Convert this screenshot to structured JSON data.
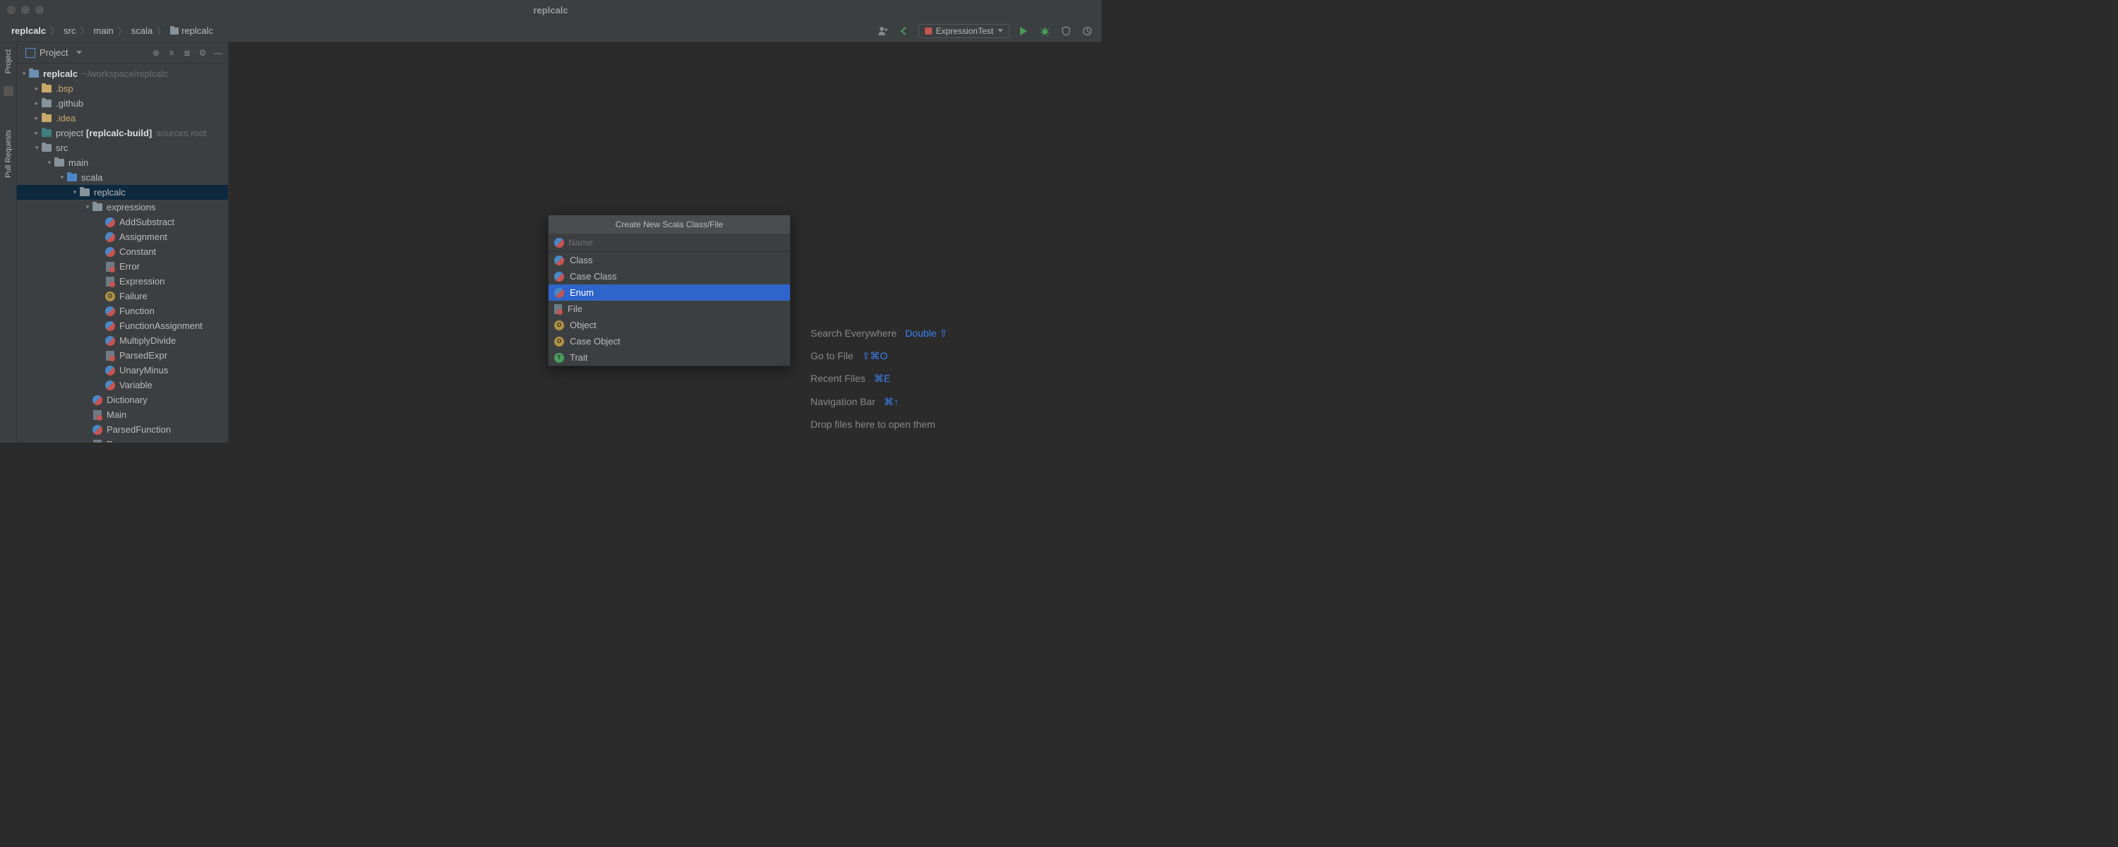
{
  "window": {
    "title": "replcalc"
  },
  "breadcrumbs": [
    "replcalc",
    "src",
    "main",
    "scala",
    "replcalc"
  ],
  "runConfig": {
    "name": "ExpressionTest"
  },
  "sidebar": {
    "view_label": "Project",
    "root": {
      "name": "replcalc",
      "path": "~/workspace/replcalc"
    },
    "folders": {
      "bsp": ".bsp",
      "github": ".github",
      "idea": ".idea",
      "project_label": "project",
      "project_bold": "[replcalc-build]",
      "project_hint": "sources root",
      "src": "src",
      "main": "main",
      "scala": "scala",
      "pkg": "replcalc",
      "expressions": "expressions"
    },
    "files": {
      "addsub": "AddSubstract",
      "assignment": "Assignment",
      "constant": "Constant",
      "error": "Error",
      "expression": "Expression",
      "failure": "Failure",
      "function": "Function",
      "funcassign": "FunctionAssignment",
      "muldiv": "MultiplyDivide",
      "parsedexpr": "ParsedExpr",
      "unaryminus": "UnaryMinus",
      "variable": "Variable",
      "dictionary": "Dictionary",
      "maino": "Main",
      "parsedfunction": "ParsedFunction",
      "parser": "Parser"
    }
  },
  "gutter": {
    "project": "Project",
    "pull_requests": "Pull Requests"
  },
  "welcome": {
    "search": "Search Everywhere",
    "search_key": "Double ⇧",
    "goto": "Go to File",
    "goto_key": "⇧⌘O",
    "recent": "Recent Files",
    "recent_key": "⌘E",
    "navbar": "Navigation Bar",
    "navbar_key": "⌘↑",
    "drop": "Drop files here to open them"
  },
  "popup": {
    "title": "Create New Scala Class/File",
    "placeholder": "Name",
    "items": {
      "class": "Class",
      "caseclass": "Case Class",
      "enum": "Enum",
      "file": "File",
      "object": "Object",
      "caseobject": "Case Object",
      "trait": "Trait"
    },
    "selected": "enum"
  }
}
